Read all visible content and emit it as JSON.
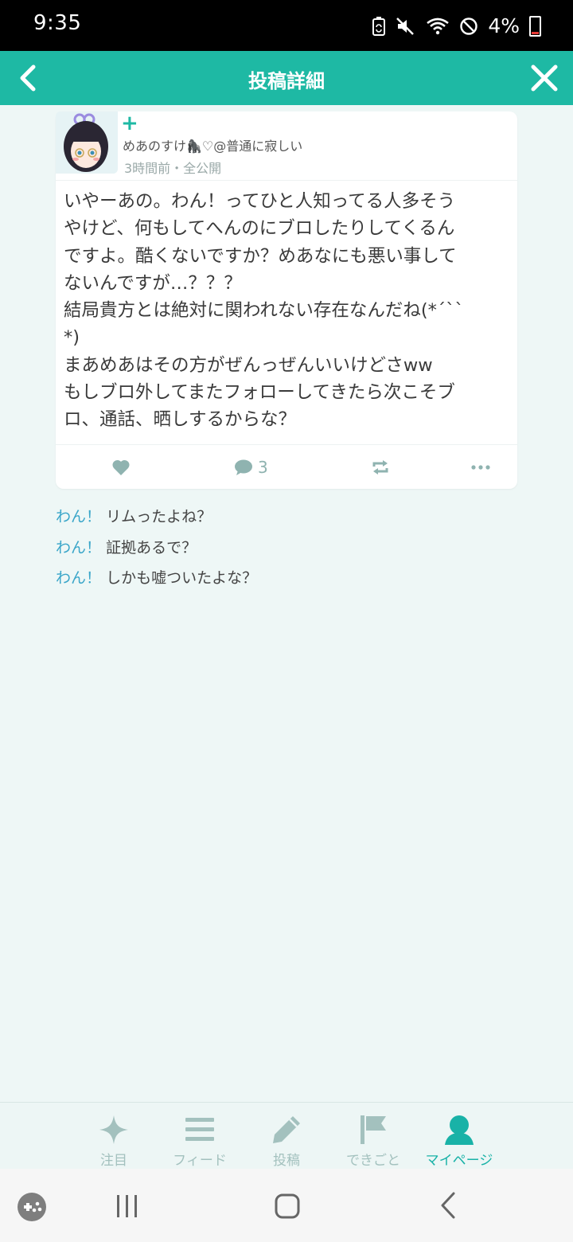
{
  "status_bar": {
    "time": "9:35",
    "battery_percent": "4%",
    "icons": [
      "battery-saver-icon",
      "mute-icon",
      "wifi-icon",
      "no-disturb-icon",
      "battery-icon"
    ]
  },
  "header": {
    "title": "投稿詳細",
    "back_icon": "chevron-left-icon",
    "close_icon": "close-icon"
  },
  "post": {
    "follow_icon": "plus-icon",
    "author": "めあのすけ🦍♡@普通に寂しい",
    "meta": "3時間前・全公開",
    "body": "いやーあの。わん！ってひと人知ってる人多そう\nやけど、何もしてへんのにブロしたりしてくるん\nですよ。酷くないですか？めあなにも悪い事して\nないんですが…？？？\n結局貴方とは絶対に関われない存在なんだね(*´``\n*)\nまあめあはその方がぜんっぜんいいけどさww\nもしブロ外してまたフォローしてきたら次こそブ\nロ、通話、晒しするからな？",
    "actions": {
      "like_icon": "heart-icon",
      "comment_icon": "comment-icon",
      "comment_count": "3",
      "repost_icon": "repost-icon",
      "more_icon": "more-icon"
    }
  },
  "comments": [
    {
      "name": "わん！",
      "text": "リムったよね？"
    },
    {
      "name": "わん！",
      "text": "証拠あるで？"
    },
    {
      "name": "わん！",
      "text": "しかも嘘ついたよな？"
    }
  ],
  "tabs": [
    {
      "label": "注目",
      "icon": "sparkle-icon",
      "active": false
    },
    {
      "label": "フィード",
      "icon": "menu-icon",
      "active": false
    },
    {
      "label": "投稿",
      "icon": "pencil-icon",
      "active": false
    },
    {
      "label": "できごと",
      "icon": "flag-icon",
      "active": false
    },
    {
      "label": "マイページ",
      "icon": "person-icon",
      "active": true
    }
  ],
  "colors": {
    "accent": "#1eb9a4",
    "background": "#eef7f6",
    "comment_name": "#3aa6c9",
    "inactive_icon": "#a3c1be"
  }
}
